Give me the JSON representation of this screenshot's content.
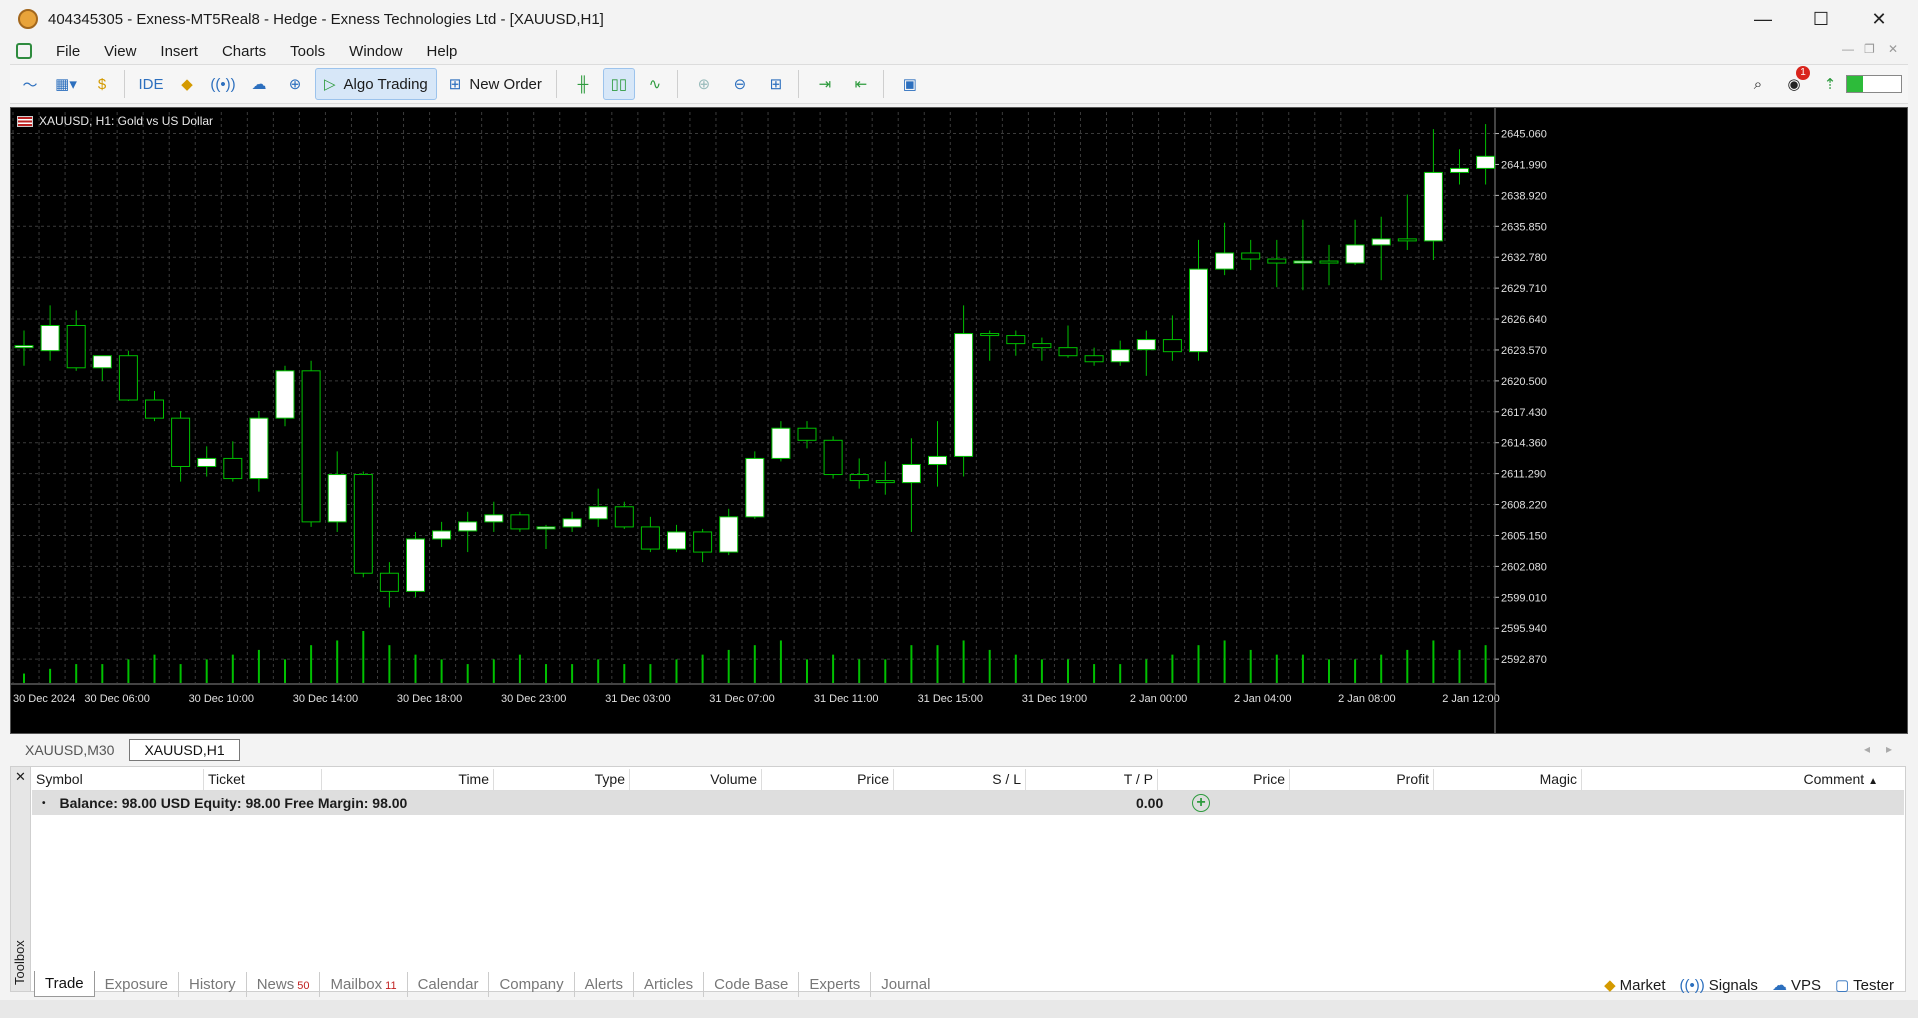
{
  "window": {
    "title": "404345305 - Exness-MT5Real8 - Hedge - Exness Technologies Ltd - [XAUUSD,H1]",
    "minimize": "—",
    "maximize": "☐",
    "close": "✕"
  },
  "menu": [
    "File",
    "View",
    "Insert",
    "Charts",
    "Tools",
    "Window",
    "Help"
  ],
  "toolbar": {
    "ide": "IDE",
    "algo_trading": "Algo Trading",
    "new_order": "New Order",
    "notifications_count": "1"
  },
  "chart": {
    "legend": "XAUUSD, H1:  Gold vs US Dollar",
    "colors": {
      "bg": "#000000",
      "grid": "#3b3b3b",
      "up": "#ffffff",
      "down": "#000000",
      "wick": "#00c000",
      "volume": "#00c000",
      "text": "#e0e0e0"
    }
  },
  "chart_data": {
    "type": "candlestick",
    "symbol": "XAUUSD",
    "timeframe": "H1",
    "y_ticks": [
      "2645.060",
      "2641.990",
      "2638.920",
      "2635.850",
      "2632.780",
      "2629.710",
      "2626.640",
      "2623.570",
      "2620.500",
      "2617.430",
      "2614.360",
      "2611.290",
      "2608.220",
      "2605.150",
      "2602.080",
      "2599.010",
      "2595.940",
      "2592.870"
    ],
    "ylim": [
      2590.5,
      2647.2
    ],
    "x_ticks": [
      "30 Dec 2024",
      "30 Dec 06:00",
      "30 Dec 10:00",
      "30 Dec 14:00",
      "30 Dec 18:00",
      "30 Dec 23:00",
      "31 Dec 03:00",
      "31 Dec 07:00",
      "31 Dec 11:00",
      "31 Dec 15:00",
      "31 Dec 19:00",
      "2 Jan 00:00",
      "2 Jan 04:00",
      "2 Jan 08:00",
      "2 Jan 12:00"
    ],
    "candles": [
      [
        2624.0,
        2625.5,
        2622.0,
        2624.0
      ],
      [
        2623.5,
        2628.0,
        2622.5,
        2626.0
      ],
      [
        2626.0,
        2627.5,
        2621.5,
        2621.8
      ],
      [
        2621.8,
        2623.0,
        2620.5,
        2623.0
      ],
      [
        2623.0,
        2623.5,
        2618.5,
        2618.6
      ],
      [
        2618.6,
        2619.5,
        2616.5,
        2616.8
      ],
      [
        2616.8,
        2617.5,
        2610.5,
        2612.0
      ],
      [
        2612.0,
        2614.0,
        2611.0,
        2612.8
      ],
      [
        2612.8,
        2614.5,
        2610.5,
        2610.8
      ],
      [
        2610.8,
        2617.5,
        2609.5,
        2616.8
      ],
      [
        2616.8,
        2622.0,
        2616.0,
        2621.5
      ],
      [
        2621.5,
        2622.5,
        2606.0,
        2606.5
      ],
      [
        2606.5,
        2613.5,
        2605.5,
        2611.2
      ],
      [
        2611.2,
        2611.5,
        2601.0,
        2601.4
      ],
      [
        2601.4,
        2602.5,
        2598.0,
        2599.6
      ],
      [
        2599.6,
        2605.5,
        2599.0,
        2604.8
      ],
      [
        2604.8,
        2606.5,
        2604.0,
        2605.6
      ],
      [
        2605.6,
        2607.5,
        2603.5,
        2606.5
      ],
      [
        2606.5,
        2608.5,
        2605.5,
        2607.2
      ],
      [
        2607.2,
        2607.5,
        2605.5,
        2605.8
      ],
      [
        2605.8,
        2606.2,
        2603.8,
        2606.0
      ],
      [
        2606.0,
        2607.5,
        2605.5,
        2606.8
      ],
      [
        2606.8,
        2609.8,
        2606.0,
        2608.0
      ],
      [
        2608.0,
        2608.5,
        2605.8,
        2606.0
      ],
      [
        2606.0,
        2607.0,
        2603.5,
        2603.8
      ],
      [
        2603.8,
        2606.2,
        2603.5,
        2605.5
      ],
      [
        2605.5,
        2605.8,
        2602.5,
        2603.5
      ],
      [
        2603.5,
        2607.8,
        2603.2,
        2607.0
      ],
      [
        2607.0,
        2613.5,
        2606.8,
        2612.8
      ],
      [
        2612.8,
        2616.5,
        2612.5,
        2615.8
      ],
      [
        2615.8,
        2616.5,
        2613.8,
        2614.6
      ],
      [
        2614.6,
        2615.0,
        2610.8,
        2611.2
      ],
      [
        2611.2,
        2612.8,
        2609.8,
        2610.6
      ],
      [
        2610.6,
        2612.5,
        2609.2,
        2610.4
      ],
      [
        2610.4,
        2614.8,
        2605.5,
        2612.2
      ],
      [
        2612.2,
        2616.5,
        2610.0,
        2613.0
      ],
      [
        2613.0,
        2628.0,
        2611.0,
        2625.2
      ],
      [
        2625.2,
        2625.5,
        2622.5,
        2625.0
      ],
      [
        2625.0,
        2625.5,
        2623.0,
        2624.2
      ],
      [
        2624.2,
        2624.8,
        2622.5,
        2623.8
      ],
      [
        2623.8,
        2626.0,
        2622.8,
        2623.0
      ],
      [
        2623.0,
        2623.8,
        2622.0,
        2622.4
      ],
      [
        2622.4,
        2624.5,
        2622.0,
        2623.6
      ],
      [
        2623.6,
        2625.5,
        2621.0,
        2624.6
      ],
      [
        2624.6,
        2627.0,
        2622.5,
        2623.4
      ],
      [
        2623.4,
        2634.5,
        2622.5,
        2631.6
      ],
      [
        2631.6,
        2636.2,
        2631.0,
        2633.2
      ],
      [
        2633.2,
        2634.5,
        2631.5,
        2632.6
      ],
      [
        2632.6,
        2634.5,
        2629.8,
        2632.2
      ],
      [
        2632.2,
        2636.5,
        2629.5,
        2632.4
      ],
      [
        2632.4,
        2634.0,
        2630.0,
        2632.2
      ],
      [
        2632.2,
        2636.5,
        2632.0,
        2634.0
      ],
      [
        2634.0,
        2636.8,
        2630.5,
        2634.6
      ],
      [
        2634.6,
        2639.0,
        2633.5,
        2634.4
      ],
      [
        2634.4,
        2645.5,
        2632.5,
        2641.2
      ],
      [
        2641.2,
        2643.5,
        2640.0,
        2641.6
      ],
      [
        2641.6,
        2646.0,
        2640.0,
        2642.8
      ]
    ],
    "volumes": [
      2,
      3,
      4,
      4,
      5,
      6,
      4,
      5,
      6,
      7,
      5,
      8,
      9,
      11,
      8,
      6,
      5,
      4,
      5,
      6,
      4,
      4,
      5,
      4,
      4,
      5,
      6,
      7,
      8,
      9,
      5,
      6,
      5,
      5,
      8,
      8,
      9,
      7,
      6,
      5,
      5,
      4,
      4,
      5,
      6,
      8,
      9,
      7,
      6,
      6,
      5,
      5,
      6,
      7,
      9,
      7,
      8
    ],
    "grid": true
  },
  "chart_tabs": [
    "XAUUSD,M30",
    "XAUUSD,H1"
  ],
  "toolbox": {
    "label": "Toolbox",
    "columns": [
      "Symbol",
      "Ticket",
      "Time",
      "Type",
      "Volume",
      "Price",
      "S / L",
      "T / P",
      "Price",
      "Profit",
      "Magic",
      "Comment"
    ],
    "balance_text": "Balance: 98.00 USD  Equity: 98.00  Free Margin: 98.00",
    "profit": "0.00"
  },
  "bottom_tabs": [
    {
      "label": "Trade",
      "count": ""
    },
    {
      "label": "Exposure",
      "count": ""
    },
    {
      "label": "History",
      "count": ""
    },
    {
      "label": "News",
      "count": "50"
    },
    {
      "label": "Mailbox",
      "count": "11"
    },
    {
      "label": "Calendar",
      "count": ""
    },
    {
      "label": "Company",
      "count": ""
    },
    {
      "label": "Alerts",
      "count": ""
    },
    {
      "label": "Articles",
      "count": ""
    },
    {
      "label": "Code Base",
      "count": ""
    },
    {
      "label": "Experts",
      "count": ""
    },
    {
      "label": "Journal",
      "count": ""
    }
  ],
  "bottom_right": {
    "market": "Market",
    "signals": "Signals",
    "vps": "VPS",
    "tester": "Tester"
  }
}
